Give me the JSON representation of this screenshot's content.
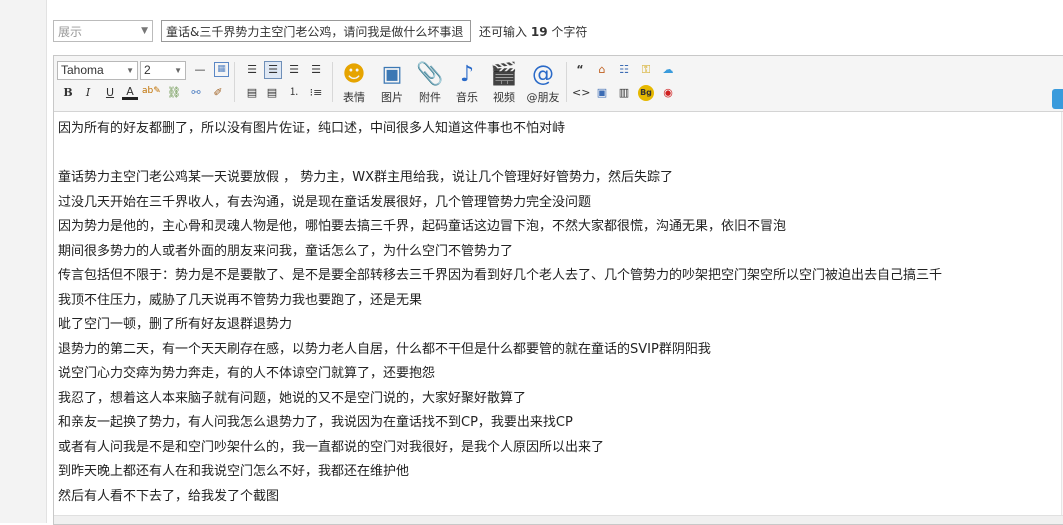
{
  "topbar": {
    "category_value": "展示",
    "title_value": "童话&三千界势力主空门老公鸡，请问我是做什么坏事退",
    "char_hint_prefix": "还可输入",
    "char_hint_count": "19",
    "char_hint_suffix": "个字符"
  },
  "toolbar": {
    "font_family": "Tahoma",
    "font_size": "2",
    "big_buttons": [
      {
        "icon": "smiley-icon",
        "label": "表情"
      },
      {
        "icon": "image-icon",
        "label": "图片"
      },
      {
        "icon": "paperclip-icon",
        "label": "附件"
      },
      {
        "icon": "music-note-icon",
        "label": "音乐"
      },
      {
        "icon": "video-icon",
        "label": "视频"
      },
      {
        "icon": "at-icon",
        "label": "@朋友"
      }
    ]
  },
  "content": {
    "lines": [
      "因为所有的好友都删了，所以没有图片佐证，纯口述，中间很多人知道这件事也不怕对峙",
      "",
      "童话势力主空门老公鸡某一天说要放假 ， 势力主，WX群主甩给我，说让几个管理好好管势力，然后失踪了",
      "过没几天开始在三千界收人，有去沟通，说是现在童话发展很好，几个管理管势力完全没问题",
      "因为势力是他的，主心骨和灵魂人物是他，哪怕要去搞三千界，起码童话这边冒下泡，不然大家都很慌，沟通无果，依旧不冒泡",
      "期间很多势力的人或者外面的朋友来问我，童话怎么了，为什么空门不管势力了",
      "传言包括但不限于：势力是不是要散了、是不是要全部转移去三千界因为看到好几个老人去了、几个管势力的吵架把空门架空所以空门被迫出去自己搞三千",
      "我顶不住压力，威胁了几天说再不管势力我也要跑了，还是无果",
      "呲了空门一顿，删了所有好友退群退势力",
      "退势力的第二天，有一个天天刷存在感，以势力老人自居，什么都不干但是什么都要管的就在童话的SVIP群阴阳我",
      "说空门心力交瘁为势力奔走，有的人不体谅空门就算了，还要抱怨",
      "我忍了，想着这人本来脑子就有问题，她说的又不是空门说的，大家好聚好散算了",
      "和亲友一起换了势力，有人问我怎么退势力了，我说因为在童话找不到CP，我要出来找CP",
      "或者有人问我是不是和空门吵架什么的，我一直都说的空门对我很好，是我个人原因所以出来了",
      "到昨天晚上都还有人在和我说空门怎么不好，我都还在维护他",
      "然后有人看不下去了，给我发了个截图"
    ]
  }
}
